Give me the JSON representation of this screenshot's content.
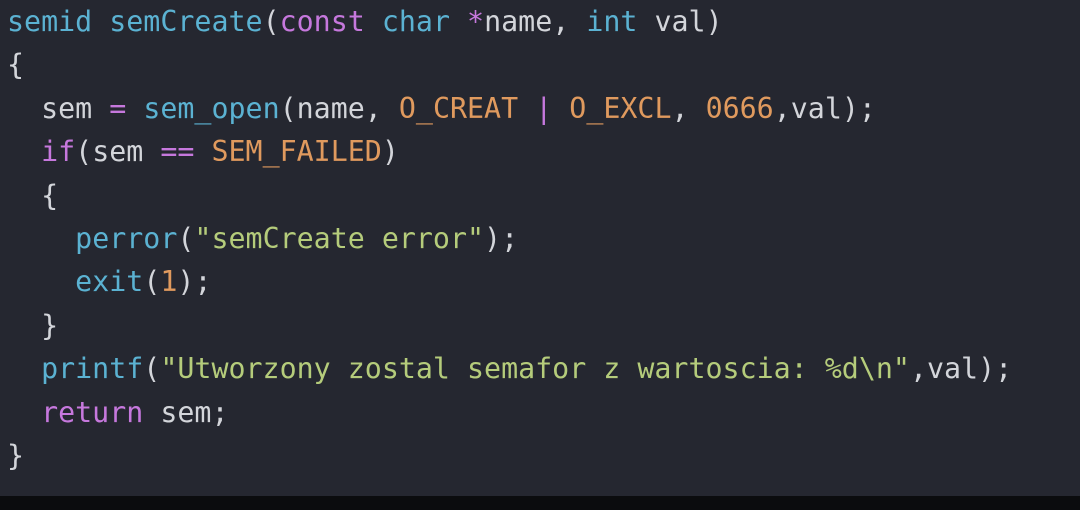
{
  "code": {
    "lines": [
      [
        {
          "t": "semid",
          "k": "type"
        },
        {
          "t": " ",
          "k": "ident"
        },
        {
          "t": "semCreate",
          "k": "fn"
        },
        {
          "t": "(",
          "k": "punct"
        },
        {
          "t": "const",
          "k": "kw"
        },
        {
          "t": " ",
          "k": "ident"
        },
        {
          "t": "char",
          "k": "type"
        },
        {
          "t": " ",
          "k": "ident"
        },
        {
          "t": "*",
          "k": "op"
        },
        {
          "t": "name, ",
          "k": "ident"
        },
        {
          "t": "int",
          "k": "type"
        },
        {
          "t": " val)",
          "k": "ident"
        }
      ],
      [
        {
          "t": "{",
          "k": "punct"
        }
      ],
      [
        {
          "t": "  sem ",
          "k": "ident"
        },
        {
          "t": "=",
          "k": "op"
        },
        {
          "t": " ",
          "k": "ident"
        },
        {
          "t": "sem_open",
          "k": "fn"
        },
        {
          "t": "(name, ",
          "k": "ident"
        },
        {
          "t": "O_CREAT",
          "k": "const"
        },
        {
          "t": " ",
          "k": "ident"
        },
        {
          "t": "|",
          "k": "op"
        },
        {
          "t": " ",
          "k": "ident"
        },
        {
          "t": "O_EXCL",
          "k": "const"
        },
        {
          "t": ", ",
          "k": "ident"
        },
        {
          "t": "0666",
          "k": "num"
        },
        {
          "t": ",val);",
          "k": "ident"
        }
      ],
      [
        {
          "t": "  ",
          "k": "ident"
        },
        {
          "t": "if",
          "k": "kw"
        },
        {
          "t": "(sem ",
          "k": "ident"
        },
        {
          "t": "==",
          "k": "op"
        },
        {
          "t": " ",
          "k": "ident"
        },
        {
          "t": "SEM_FAILED",
          "k": "const"
        },
        {
          "t": ")",
          "k": "ident"
        }
      ],
      [
        {
          "t": "  {",
          "k": "punct"
        }
      ],
      [
        {
          "t": "    ",
          "k": "ident"
        },
        {
          "t": "perror",
          "k": "fn"
        },
        {
          "t": "(",
          "k": "punct"
        },
        {
          "t": "\"semCreate error\"",
          "k": "str"
        },
        {
          "t": ");",
          "k": "punct"
        }
      ],
      [
        {
          "t": "    ",
          "k": "ident"
        },
        {
          "t": "exit",
          "k": "fn"
        },
        {
          "t": "(",
          "k": "punct"
        },
        {
          "t": "1",
          "k": "num"
        },
        {
          "t": ");",
          "k": "punct"
        }
      ],
      [
        {
          "t": "  }",
          "k": "punct"
        }
      ],
      [
        {
          "t": "  ",
          "k": "ident"
        },
        {
          "t": "printf",
          "k": "fn"
        },
        {
          "t": "(",
          "k": "punct"
        },
        {
          "t": "\"Utworzony zostal semafor z wartoscia: %d\\n\"",
          "k": "str"
        },
        {
          "t": ",val);",
          "k": "ident"
        }
      ],
      [
        {
          "t": "  ",
          "k": "ident"
        },
        {
          "t": "return",
          "k": "kw"
        },
        {
          "t": " sem;",
          "k": "ident"
        }
      ],
      [
        {
          "t": "}",
          "k": "punct"
        }
      ]
    ]
  },
  "colors": {
    "background": "#252730",
    "type_and_function": "#5bb2d2",
    "keyword_and_operator": "#c678dd",
    "constant_and_number": "#e09a5e",
    "string": "#b5cc7b",
    "default_text": "#d3d5da"
  }
}
